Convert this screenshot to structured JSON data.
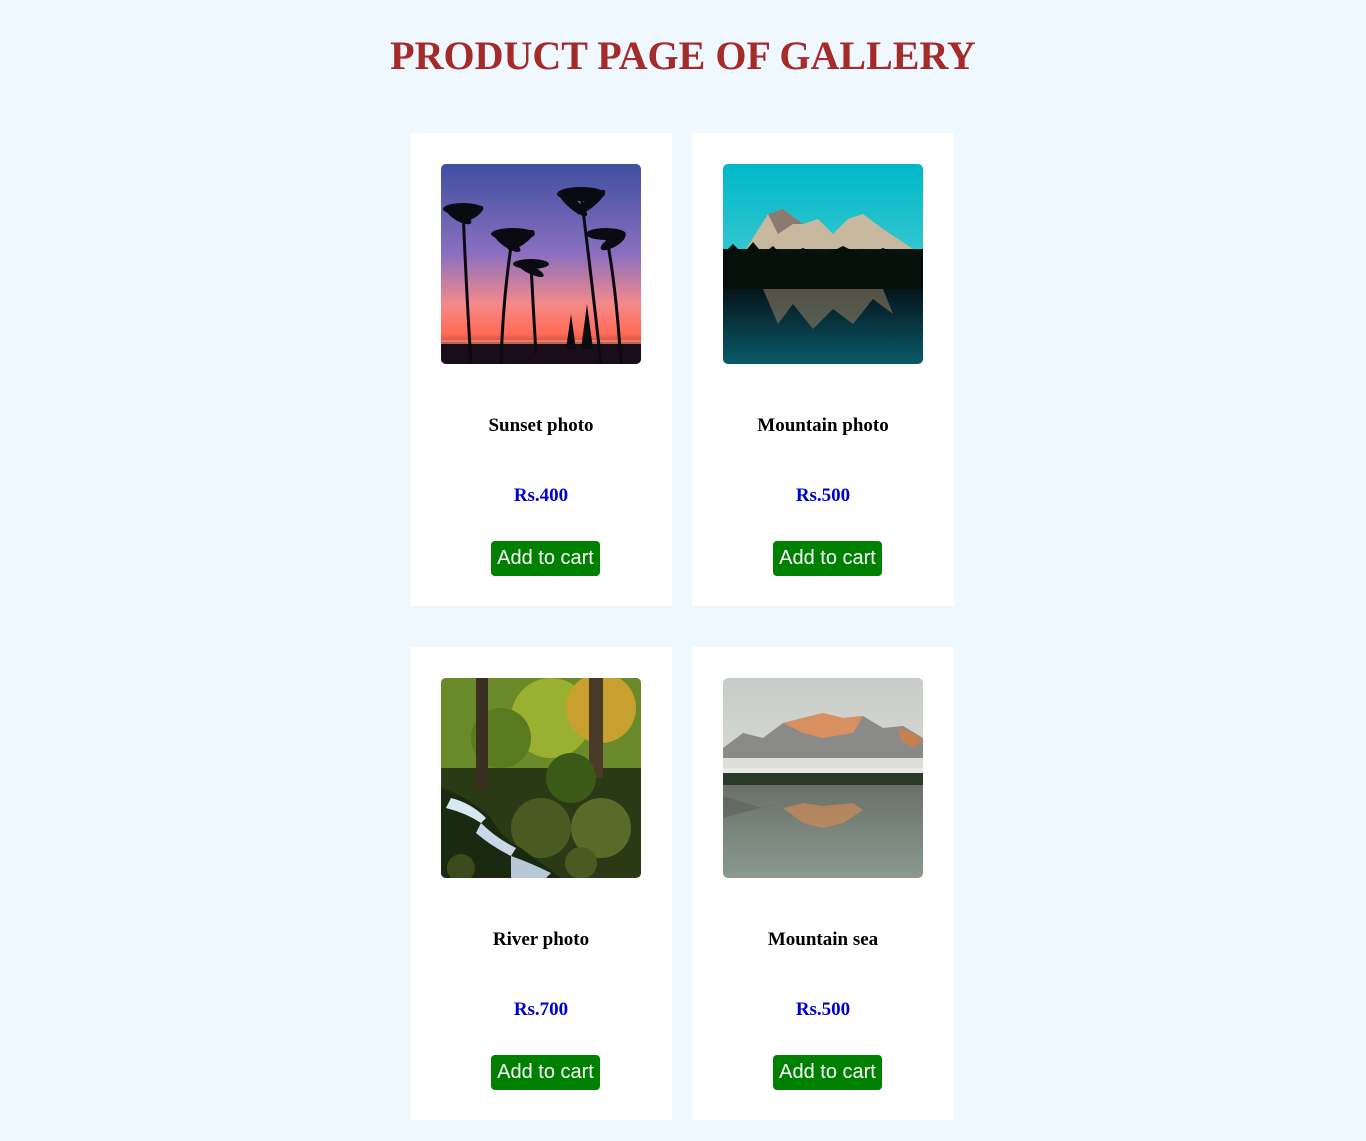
{
  "page": {
    "title": "PRODUCT PAGE OF GALLERY",
    "background": "#eff7ff",
    "title_color": "#a52a2a"
  },
  "products": [
    {
      "name": "Sunset photo",
      "price": "Rs.400",
      "button_label": "Add to cart",
      "image": "sunset-palm-image"
    },
    {
      "name": "Mountain photo",
      "price": "Rs.500",
      "button_label": "Add to cart",
      "image": "mountain-lake-image"
    },
    {
      "name": "River photo",
      "price": "Rs.700",
      "button_label": "Add to cart",
      "image": "forest-waterfall-image"
    },
    {
      "name": "Mountain sea",
      "price": "Rs.500",
      "button_label": "Add to cart",
      "image": "misty-mountain-lake-image"
    }
  ],
  "colors": {
    "price": "#0000cd",
    "button": "#008000",
    "button_text": "#ffffff"
  }
}
